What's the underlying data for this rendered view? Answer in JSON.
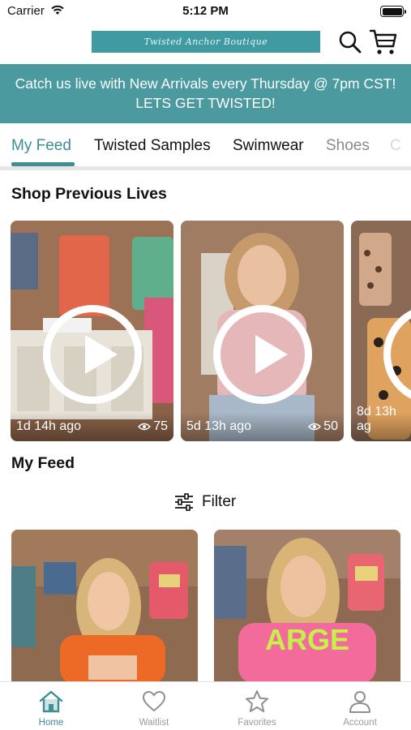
{
  "status_bar": {
    "carrier": "Carrier",
    "time": "5:12 PM"
  },
  "header": {
    "logo_text": "Twisted Anchor Boutique",
    "brand_color": "#3f9aa2"
  },
  "banner": {
    "line1": "Catch us live with New Arrivals every Thursday @ 7pm CST!",
    "line2": "LETS GET TWISTED!",
    "background": "#4a9a9f"
  },
  "tabs": [
    {
      "label": "My Feed",
      "active": true
    },
    {
      "label": "Twisted Samples"
    },
    {
      "label": "Swimwear"
    },
    {
      "label": "Shoes"
    },
    {
      "label": "C"
    }
  ],
  "previous_lives": {
    "title": "Shop Previous Lives",
    "items": [
      {
        "age": "1d 14h ago",
        "views": "75"
      },
      {
        "age": "5d 13h ago",
        "views": "50"
      },
      {
        "age": "8d 13h ag",
        "views": ""
      }
    ]
  },
  "feed": {
    "title": "My Feed",
    "filter_label": "Filter"
  },
  "bottom_nav": [
    {
      "label": "Home",
      "icon": "home-icon",
      "active": true
    },
    {
      "label": "Waitlist",
      "icon": "heart-icon"
    },
    {
      "label": "Favorites",
      "icon": "star-icon"
    },
    {
      "label": "Account",
      "icon": "person-icon"
    }
  ],
  "accent_color": "#3f8e94"
}
